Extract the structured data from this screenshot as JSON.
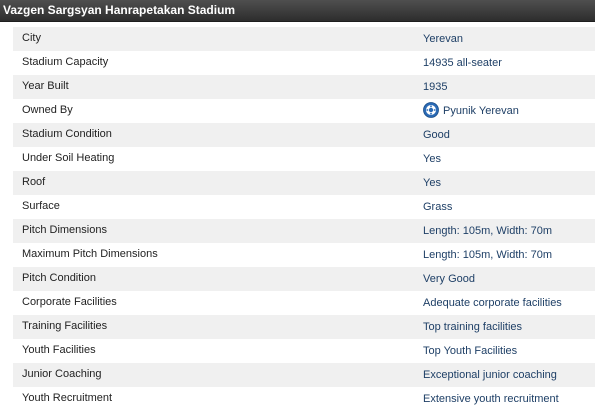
{
  "header": {
    "title": "Vazgen Sargsyan Hanrapetakan Stadium"
  },
  "rows": [
    {
      "label": "City",
      "value": "Yerevan"
    },
    {
      "label": "Stadium Capacity",
      "value": "14935 all-seater"
    },
    {
      "label": "Year Built",
      "value": "1935"
    },
    {
      "label": "Owned By",
      "value": "Pyunik Yerevan",
      "icon": "club-crest-icon"
    },
    {
      "label": "Stadium Condition",
      "value": "Good"
    },
    {
      "label": "Under Soil Heating",
      "value": "Yes"
    },
    {
      "label": "Roof",
      "value": "Yes"
    },
    {
      "label": "Surface",
      "value": "Grass"
    },
    {
      "label": "Pitch Dimensions",
      "value": "Length: 105m, Width: 70m"
    },
    {
      "label": "Maximum Pitch Dimensions",
      "value": "Length: 105m, Width: 70m"
    },
    {
      "label": "Pitch Condition",
      "value": "Very Good"
    },
    {
      "label": "Corporate Facilities",
      "value": "Adequate corporate facilities"
    },
    {
      "label": "Training Facilities",
      "value": "Top training facilities"
    },
    {
      "label": "Youth Facilities",
      "value": "Top Youth Facilities"
    },
    {
      "label": "Junior Coaching",
      "value": "Exceptional junior coaching"
    },
    {
      "label": "Youth Recruitment",
      "value": "Extensive youth recruitment"
    }
  ],
  "colors": {
    "header_bg": "#3a3a3a",
    "row_alt_bg": "#f0f0f0",
    "label_text": "#222222",
    "value_text": "#1e3f66",
    "crest_blue": "#2a6ab5"
  }
}
